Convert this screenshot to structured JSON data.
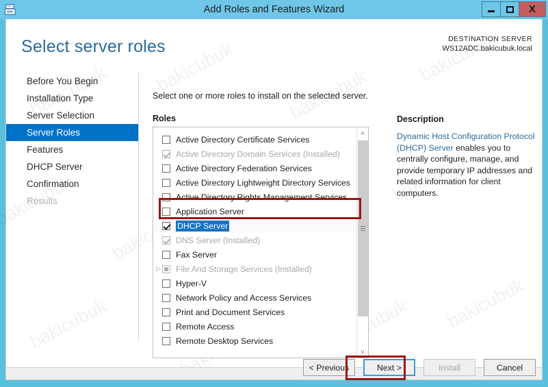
{
  "window": {
    "title": "Add Roles and Features Wizard",
    "app_icon": "server-rack-icon",
    "minimize_label": "–",
    "maximize_label": "□",
    "close_label": "X",
    "close_color": "#c75b5b",
    "titlebar_color": "#6ec6e8"
  },
  "header": {
    "page_title": "Select server roles",
    "destination_label": "DESTINATION SERVER",
    "destination_value": "WS12ADC.bakicubuk.local",
    "title_color": "#2a6b9c"
  },
  "sidebar": {
    "accent_color": "#0072c6",
    "items": [
      {
        "label": "Before You Begin",
        "state": "normal"
      },
      {
        "label": "Installation Type",
        "state": "normal"
      },
      {
        "label": "Server Selection",
        "state": "normal"
      },
      {
        "label": "Server Roles",
        "state": "active"
      },
      {
        "label": "Features",
        "state": "normal"
      },
      {
        "label": "DHCP Server",
        "state": "normal"
      },
      {
        "label": "Confirmation",
        "state": "normal"
      },
      {
        "label": "Results",
        "state": "disabled"
      }
    ]
  },
  "main": {
    "instruction": "Select one or more roles to install on the selected server.",
    "roles_label": "Roles",
    "roles": [
      {
        "label": "Active Directory Certificate Services",
        "checked": false,
        "disabled": false,
        "selected": false,
        "expander": false
      },
      {
        "label": "Active Directory Domain Services (Installed)",
        "checked": true,
        "disabled": true,
        "selected": false,
        "expander": false
      },
      {
        "label": "Active Directory Federation Services",
        "checked": false,
        "disabled": false,
        "selected": false,
        "expander": false
      },
      {
        "label": "Active Directory Lightweight Directory Services",
        "checked": false,
        "disabled": false,
        "selected": false,
        "expander": false
      },
      {
        "label": "Active Directory Rights Management Services",
        "checked": false,
        "disabled": false,
        "selected": false,
        "expander": false
      },
      {
        "label": "Application Server",
        "checked": false,
        "disabled": false,
        "selected": false,
        "expander": false
      },
      {
        "label": "DHCP Server",
        "checked": true,
        "disabled": false,
        "selected": true,
        "expander": false
      },
      {
        "label": "DNS Server (Installed)",
        "checked": true,
        "disabled": true,
        "selected": false,
        "expander": false
      },
      {
        "label": "Fax Server",
        "checked": false,
        "disabled": false,
        "selected": false,
        "expander": false
      },
      {
        "label": "File And Storage Services (Installed)",
        "checked": false,
        "partial": true,
        "disabled": true,
        "selected": false,
        "expander": true
      },
      {
        "label": "Hyper-V",
        "checked": false,
        "disabled": false,
        "selected": false,
        "expander": false
      },
      {
        "label": "Network Policy and Access Services",
        "checked": false,
        "disabled": false,
        "selected": false,
        "expander": false
      },
      {
        "label": "Print and Document Services",
        "checked": false,
        "disabled": false,
        "selected": false,
        "expander": false
      },
      {
        "label": "Remote Access",
        "checked": false,
        "disabled": false,
        "selected": false,
        "expander": false
      },
      {
        "label": "Remote Desktop Services",
        "checked": false,
        "disabled": false,
        "selected": false,
        "expander": false
      }
    ],
    "scrollbar": {
      "up_arrow": "˄",
      "down_arrow": "˅"
    }
  },
  "description": {
    "title": "Description",
    "highlight_text": "Dynamic Host Configuration Protocol (DHCP) Server",
    "body_text": " enables you to centrally configure, manage, and provide temporary IP addresses and related information for client computers.",
    "highlight_color": "#2a6b9c"
  },
  "footer": {
    "previous_label": "< Previous",
    "next_label": "Next >",
    "install_label": "Install",
    "cancel_label": "Cancel",
    "install_disabled": true,
    "next_focused": true
  },
  "annotations": {
    "color": "#9c1616",
    "role_row_target": "DHCP Server",
    "button_target": "Next >"
  },
  "watermark": {
    "text": "bakicubuk"
  }
}
